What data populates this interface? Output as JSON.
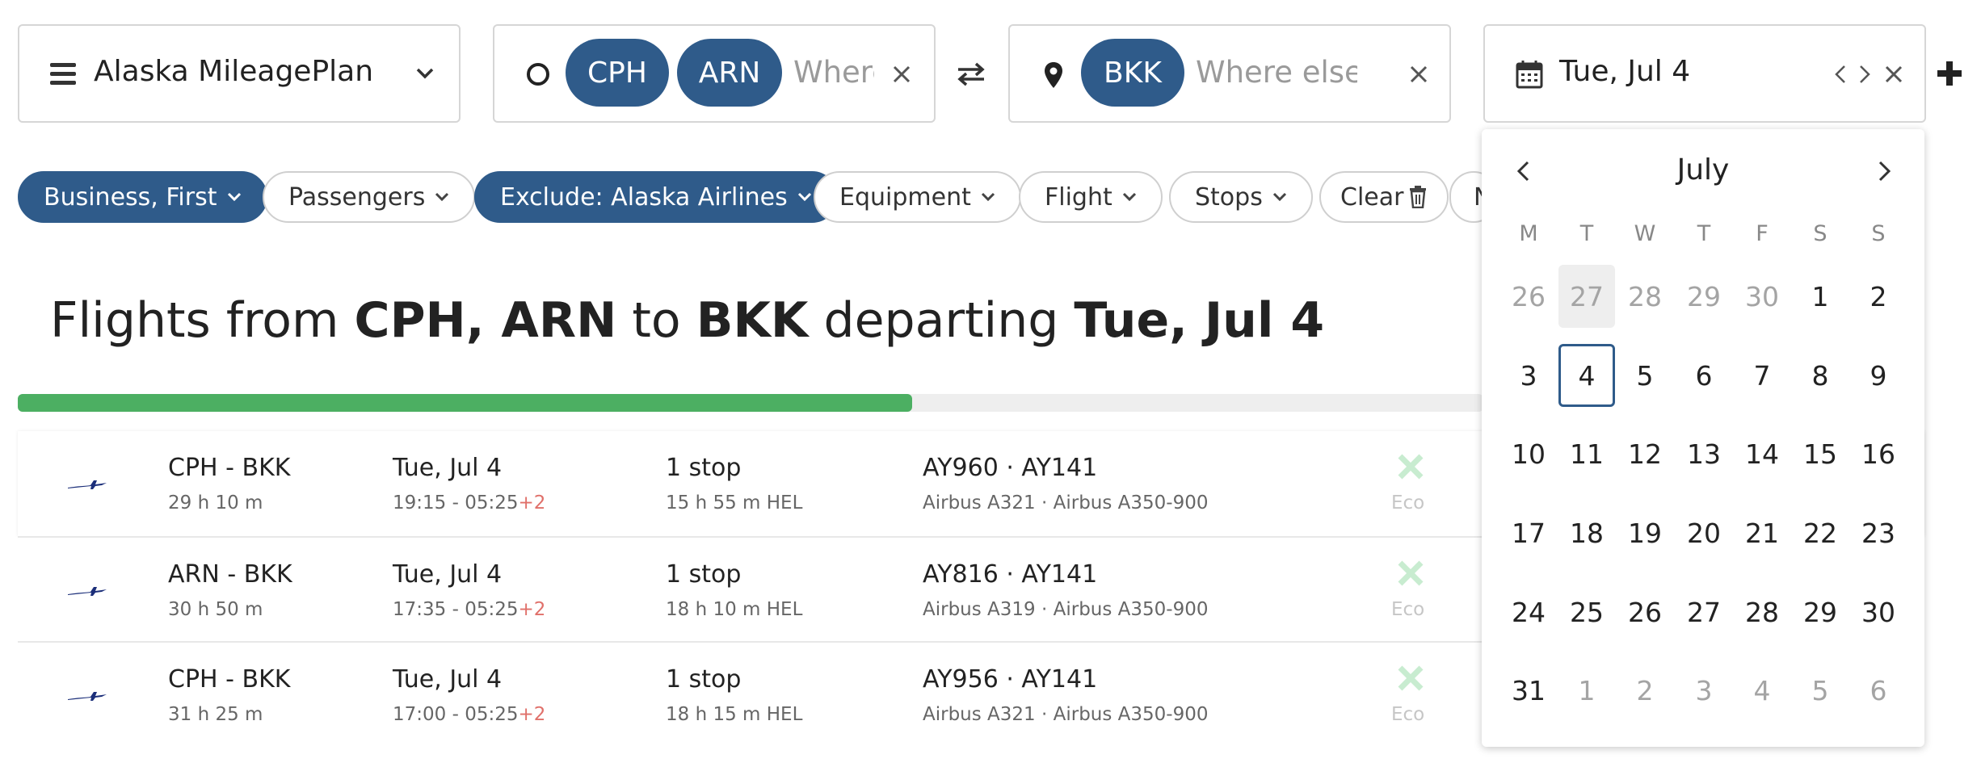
{
  "program": {
    "label": "Alaska MileagePlan"
  },
  "origin": {
    "chips": [
      "CPH",
      "ARN"
    ],
    "placeholder": "Where e"
  },
  "destination": {
    "chips": [
      "BKK"
    ],
    "placeholder": "Where else?"
  },
  "date": {
    "value": "Tue, Jul 4"
  },
  "filters": [
    {
      "label": "Business, First",
      "active": true
    },
    {
      "label": "Passengers",
      "active": false
    },
    {
      "label": "Exclude: Alaska Airlines",
      "active": true
    },
    {
      "label": "Equipment",
      "active": false
    },
    {
      "label": "Flight",
      "active": false
    },
    {
      "label": "Stops",
      "active": false
    },
    {
      "label": "Clear",
      "active": false
    },
    {
      "label": "N",
      "active": false
    }
  ],
  "heading": {
    "prefix": "Flights from ",
    "origins": "CPH, ARN",
    "mid": " to ",
    "dest": "BKK",
    "mid2": " departing ",
    "date": "Tue, Jul 4"
  },
  "progress": {
    "fraction": 0.61,
    "color": "#4caf62"
  },
  "results": [
    {
      "route": "CPH - BKK",
      "duration": "29 h 10 m",
      "date": "Tue, Jul 4",
      "times": "19:15 - 05:25",
      "plus": "+2",
      "stops": "1 stop",
      "layover": "15 h 55 m  HEL",
      "flights": "AY960  ·  AY141",
      "aircraft": "Airbus A321  ·  Airbus A350-900",
      "cabin": "Eco"
    },
    {
      "route": "ARN - BKK",
      "duration": "30 h 50 m",
      "date": "Tue, Jul 4",
      "times": "17:35 - 05:25",
      "plus": "+2",
      "stops": "1 stop",
      "layover": "18 h 10 m  HEL",
      "flights": "AY816  ·  AY141",
      "aircraft": "Airbus A319  ·  Airbus A350-900",
      "cabin": "Eco"
    },
    {
      "route": "CPH - BKK",
      "duration": "31 h 25 m",
      "date": "Tue, Jul 4",
      "times": "17:00 - 05:25",
      "plus": "+2",
      "stops": "1 stop",
      "layover": "18 h 15 m  HEL",
      "flights": "AY956  ·  AY141",
      "aircraft": "Airbus A321  ·  Airbus A350-900",
      "cabin": "Eco"
    }
  ],
  "calendar": {
    "month": "July",
    "weekdays": [
      "M",
      "T",
      "W",
      "T",
      "F",
      "S",
      "S"
    ],
    "weeks": [
      [
        "26",
        "27",
        "28",
        "29",
        "30",
        "1",
        "2"
      ],
      [
        "3",
        "4",
        "5",
        "6",
        "7",
        "8",
        "9"
      ],
      [
        "10",
        "11",
        "12",
        "13",
        "14",
        "15",
        "16"
      ],
      [
        "17",
        "18",
        "19",
        "20",
        "21",
        "22",
        "23"
      ],
      [
        "24",
        "25",
        "26",
        "27",
        "28",
        "29",
        "30"
      ],
      [
        "31",
        "1",
        "2",
        "3",
        "4",
        "5",
        "6"
      ]
    ],
    "muted": [
      [
        0,
        0
      ],
      [
        0,
        1
      ],
      [
        0,
        2
      ],
      [
        0,
        3
      ],
      [
        0,
        4
      ],
      [
        5,
        1
      ],
      [
        5,
        2
      ],
      [
        5,
        3
      ],
      [
        5,
        4
      ],
      [
        5,
        5
      ],
      [
        5,
        6
      ]
    ],
    "today": [
      0,
      1
    ],
    "selected": [
      1,
      1
    ]
  },
  "colors": {
    "accent": "#2f5b8a",
    "finnair": "#1c2f7a",
    "unavailable": "#c8ecd0"
  }
}
